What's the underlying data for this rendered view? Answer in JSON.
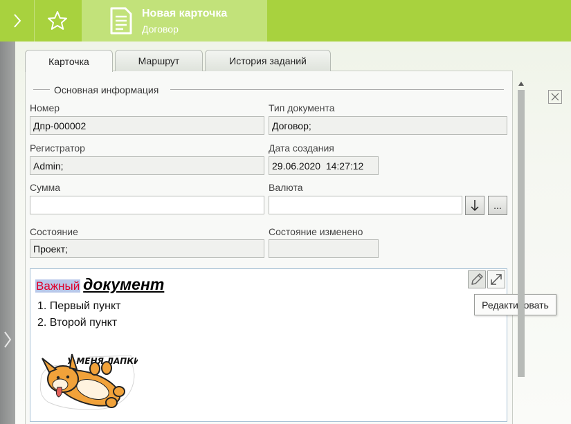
{
  "header": {
    "title": "Новая карточка",
    "subtitle": "Договор"
  },
  "tabs": [
    {
      "label": "Карточка",
      "active": true
    },
    {
      "label": "Маршрут",
      "active": false
    },
    {
      "label": "История заданий",
      "active": false
    }
  ],
  "section": {
    "title": "Основная информация"
  },
  "fields": {
    "number": {
      "label": "Номер",
      "value": "Дпр-000002"
    },
    "doc_type": {
      "label": "Тип документа",
      "value": "Договор;"
    },
    "registrar": {
      "label": "Регистратор",
      "value": "Admin;"
    },
    "created": {
      "label": "Дата создания",
      "value": "29.06.2020  14:27:12"
    },
    "sum": {
      "label": "Сумма",
      "value": ""
    },
    "currency": {
      "label": "Валюта",
      "value": ""
    },
    "state": {
      "label": "Состояние",
      "value": "Проект;"
    },
    "state_changed": {
      "label": "Состояние изменено",
      "value": ""
    }
  },
  "currency_buttons": {
    "down": "↓",
    "more": "..."
  },
  "rich_text": {
    "highlight": "Важный",
    "emphasis": "документ",
    "items": [
      "1. Первый пункт",
      "2. Второй пункт"
    ],
    "sticker_text": "У МЕНЯ ЛАПКИ"
  },
  "tooltip": "Редактировать",
  "icons": [
    "chevron-right-icon",
    "star-icon",
    "document-icon",
    "pencil-icon",
    "expand-icon",
    "close-icon"
  ],
  "colors": {
    "accent": "#a8d23e",
    "tab_highlight": "#c2e27a",
    "important_text": "#e0002a",
    "important_bg": "#b9c8ea"
  }
}
